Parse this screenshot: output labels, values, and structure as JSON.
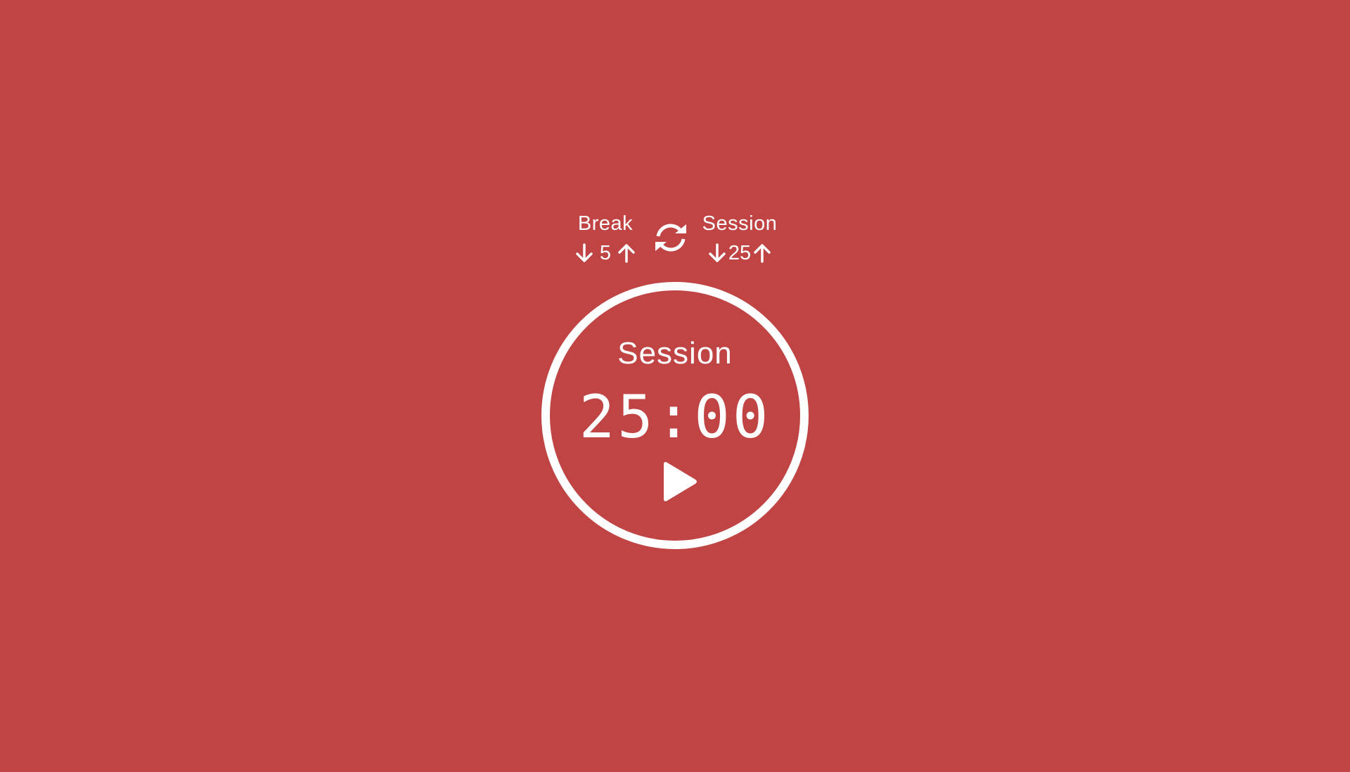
{
  "theme": {
    "background": "#c04444",
    "foreground": "#ffffff"
  },
  "break": {
    "label": "Break",
    "value": "5",
    "decrement_icon": "arrow-down-icon",
    "increment_icon": "arrow-up-icon"
  },
  "session": {
    "label": "Session",
    "value": "25",
    "decrement_icon": "arrow-down-icon",
    "increment_icon": "arrow-up-icon"
  },
  "reset": {
    "icon": "refresh-icon"
  },
  "timer": {
    "label": "Session",
    "time": "25:00",
    "play_icon": "play-icon"
  }
}
